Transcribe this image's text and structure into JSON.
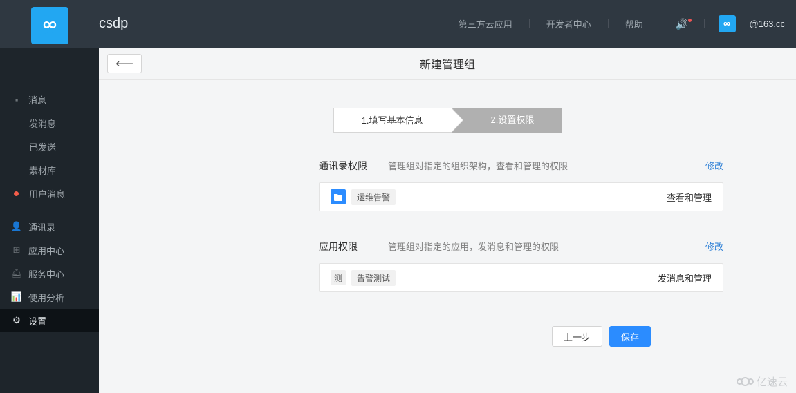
{
  "brand": "csdp",
  "topnav": {
    "links": [
      "第三方云应用",
      "开发者中心",
      "帮助"
    ],
    "user_email": "@163.cc"
  },
  "sidebar": {
    "groups": [
      {
        "icon": "message-icon",
        "label": "消息",
        "subs": [
          {
            "label": "发消息"
          },
          {
            "label": "已发送"
          },
          {
            "label": "素材库"
          },
          {
            "label": "用户消息",
            "reddot": true
          }
        ]
      },
      {
        "icon": "contacts-icon",
        "label": "通讯录"
      },
      {
        "icon": "apps-icon",
        "label": "应用中心"
      },
      {
        "icon": "service-icon",
        "label": "服务中心"
      },
      {
        "icon": "analytics-icon",
        "label": "使用分析"
      },
      {
        "icon": "settings-icon",
        "label": "设置",
        "active": true
      }
    ]
  },
  "page": {
    "title": "新建管理组",
    "steps": {
      "s1": "1.填写基本信息",
      "s2": "2.设置权限"
    }
  },
  "perm1": {
    "title": "通讯录权限",
    "desc": "管理组对指定的组织架构，查看和管理的权限",
    "edit": "修改",
    "tag": "运维告警",
    "value": "查看和管理"
  },
  "perm2": {
    "title": "应用权限",
    "desc": "管理组对指定的应用，发消息和管理的权限",
    "edit": "修改",
    "tag_prefix": "测",
    "tag": "告警测试",
    "value": "发消息和管理"
  },
  "actions": {
    "prev": "上一步",
    "save": "保存"
  },
  "watermark": "亿速云"
}
